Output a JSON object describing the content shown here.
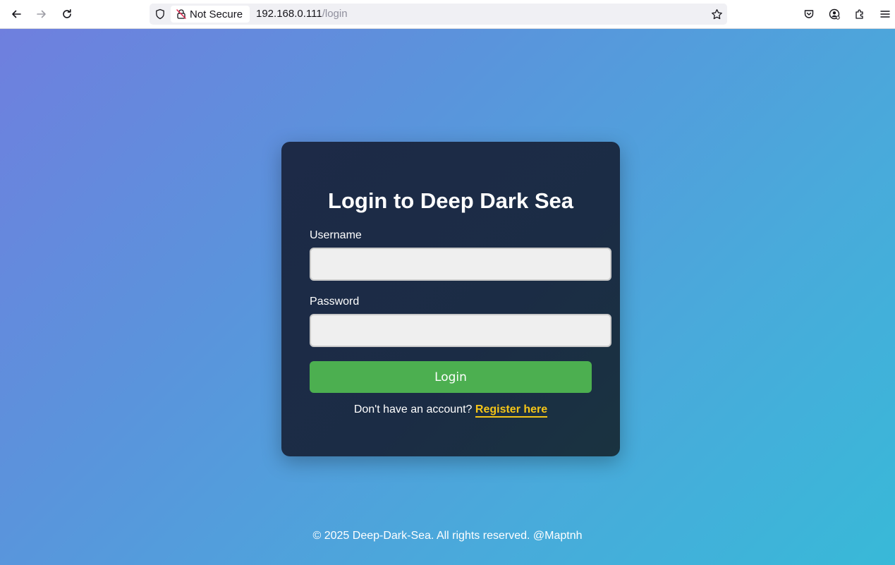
{
  "browser": {
    "security_label": "Not Secure",
    "url_host": "192.168.0.111",
    "url_path": "/login",
    "icons": [
      "back-arrow-icon",
      "forward-arrow-icon",
      "reload-icon",
      "shield-icon",
      "insecure-lock-icon",
      "bookmark-star-icon",
      "pocket-icon",
      "account-icon",
      "extensions-icon",
      "menu-icon"
    ]
  },
  "login": {
    "title": "Login to Deep Dark Sea",
    "username_label": "Username",
    "username_value": "",
    "password_label": "Password",
    "password_value": "",
    "submit_label": "Login",
    "register_prompt": "Don't have an account?",
    "register_link": "Register here"
  },
  "footer": {
    "text": "© 2025 Deep-Dark-Sea. All rights reserved. @Maptnh"
  },
  "colors": {
    "accent_button": "#4caf50",
    "link": "#f5c518",
    "card": "#1d2a47",
    "background_start": "#6f7fde",
    "background_end": "#38b9d8"
  }
}
